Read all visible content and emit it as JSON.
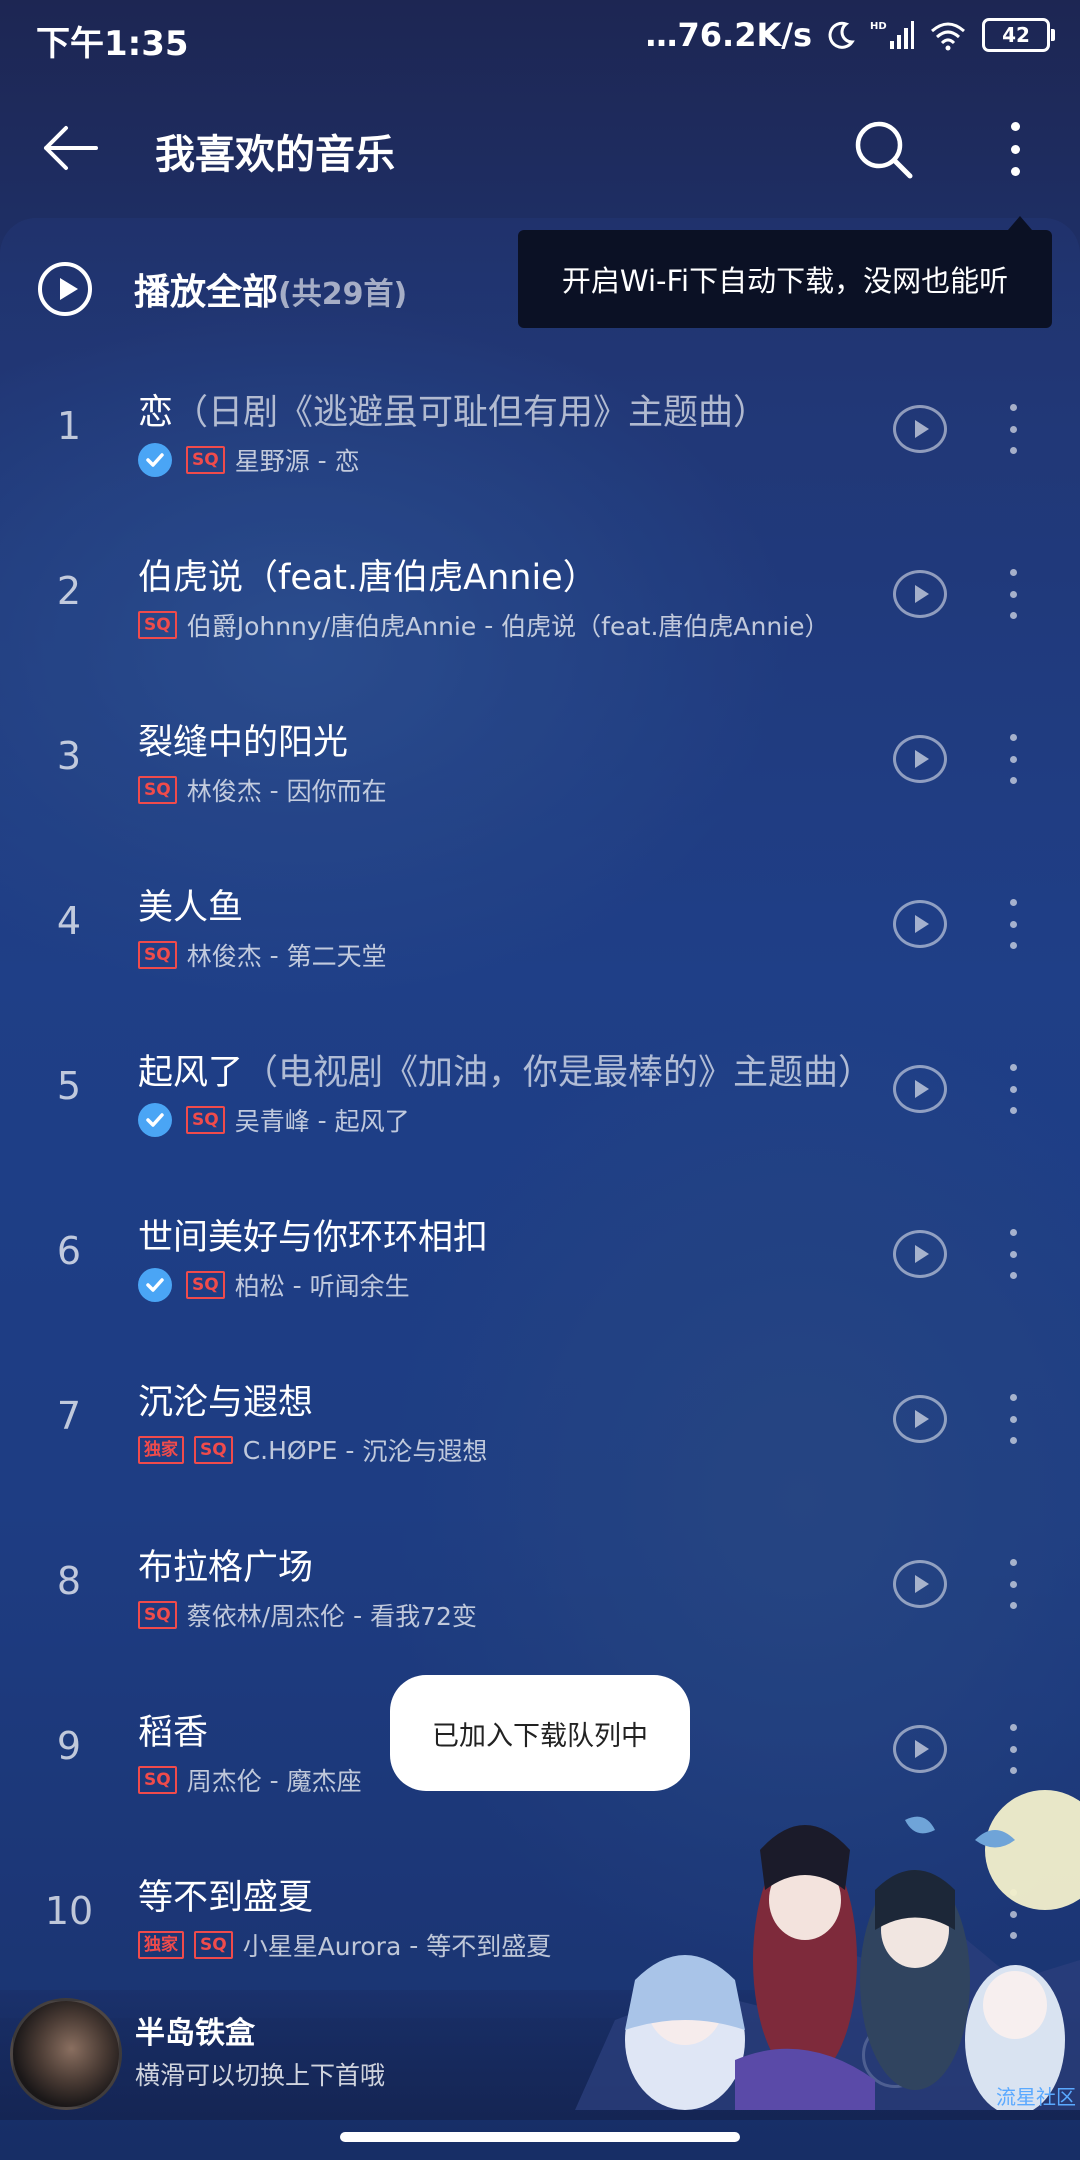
{
  "status_bar": {
    "time": "下午1:35",
    "net_speed": "…76.2K/s",
    "battery": "42"
  },
  "header": {
    "title": "我喜欢的音乐"
  },
  "play_all": {
    "label": "播放全部",
    "count": "(共29首)"
  },
  "tooltip": {
    "text": "开启Wi-Fi下自动下载，没网也能听"
  },
  "songs": [
    {
      "index": "1",
      "title": "恋",
      "subtitle": "（日剧《逃避虽可耻但有用》主题曲）",
      "downloaded": true,
      "exclusive": false,
      "sq": true,
      "artist": "星野源",
      "album": "恋"
    },
    {
      "index": "2",
      "title": "伯虎说（feat.唐伯虎Annie）",
      "subtitle": "",
      "downloaded": false,
      "exclusive": false,
      "sq": true,
      "artist": "伯爵Johnny/唐伯虎Annie",
      "album": "伯虎说（feat.唐伯虎Annie）"
    },
    {
      "index": "3",
      "title": "裂缝中的阳光",
      "subtitle": "",
      "downloaded": false,
      "exclusive": false,
      "sq": true,
      "artist": "林俊杰",
      "album": "因你而在"
    },
    {
      "index": "4",
      "title": "美人鱼",
      "subtitle": "",
      "downloaded": false,
      "exclusive": false,
      "sq": true,
      "artist": "林俊杰",
      "album": "第二天堂"
    },
    {
      "index": "5",
      "title": "起风了",
      "subtitle": "（电视剧《加油，你是最棒的》主题曲）",
      "downloaded": true,
      "exclusive": false,
      "sq": true,
      "artist": "吴青峰",
      "album": "起风了"
    },
    {
      "index": "6",
      "title": "世间美好与你环环相扣",
      "subtitle": "",
      "downloaded": true,
      "exclusive": false,
      "sq": true,
      "artist": "柏松",
      "album": "听闻余生"
    },
    {
      "index": "7",
      "title": "沉沦与遐想",
      "subtitle": "",
      "downloaded": false,
      "exclusive": true,
      "sq": true,
      "artist": "C.HØPE",
      "album": "沉沦与遐想"
    },
    {
      "index": "8",
      "title": "布拉格广场",
      "subtitle": "",
      "downloaded": false,
      "exclusive": false,
      "sq": true,
      "artist": "蔡依林/周杰伦",
      "album": "看我72变"
    },
    {
      "index": "9",
      "title": "稻香",
      "subtitle": "",
      "downloaded": false,
      "exclusive": false,
      "sq": true,
      "artist": "周杰伦",
      "album": "魔杰座"
    },
    {
      "index": "10",
      "title": "等不到盛夏",
      "subtitle": "",
      "downloaded": false,
      "exclusive": true,
      "sq": true,
      "artist": "小星星Aurora",
      "album": "等不到盛夏"
    }
  ],
  "badges": {
    "sq": "SQ",
    "exclusive": "独家",
    "separator": " - "
  },
  "toast": {
    "text": "已加入下载队列中"
  },
  "mini_player": {
    "title": "半岛铁盒",
    "subtitle": "横滑可以切换上下首哦"
  },
  "art_banner": {
    "watermark": "流星社区"
  },
  "colors": {
    "accent_check": "#4aa5f5",
    "badge_red": "#f04b4b",
    "bg_deep": "#1d3e86"
  }
}
